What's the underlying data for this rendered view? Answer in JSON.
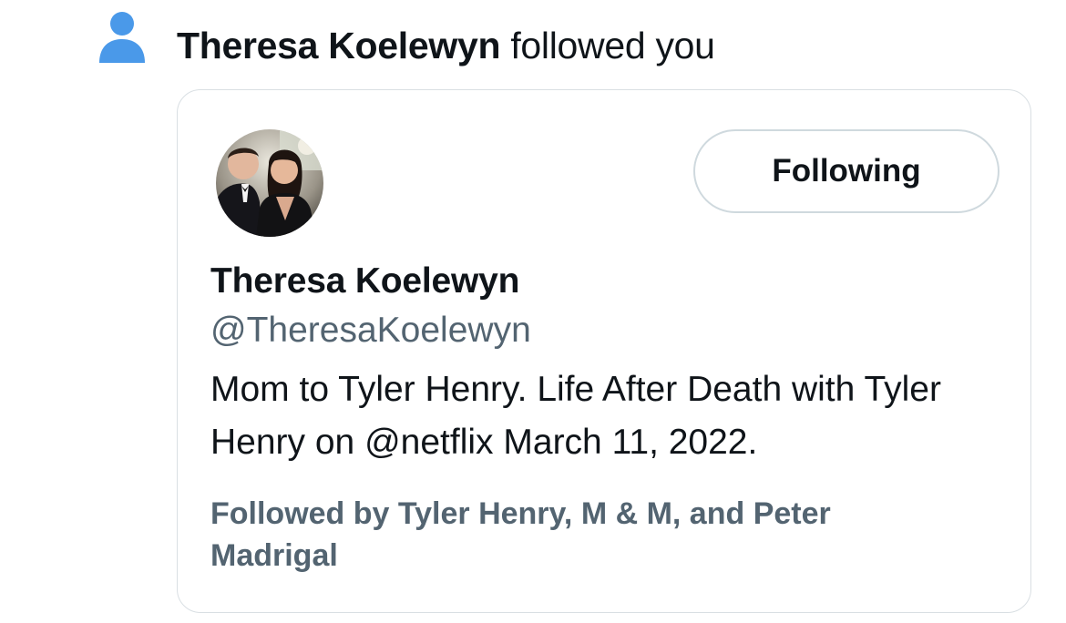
{
  "notification": {
    "icon": "person-icon",
    "icon_color": "#4a99e9",
    "follower_name": "Theresa Koelewyn",
    "action_text": "followed you"
  },
  "profile_card": {
    "avatar": "profile-photo",
    "follow_button_label": "Following",
    "display_name": "Theresa Koelewyn",
    "handle": "@TheresaKoelewyn",
    "bio": "Mom to Tyler Henry. Life After Death with Tyler Henry on @netflix March 11, 2022.",
    "followed_by": "Followed by Tyler Henry, M & M, and Peter Madrigal"
  },
  "colors": {
    "text_primary": "#0f1419",
    "text_secondary": "#536471",
    "border": "#d9dfe3",
    "button_border": "#cfd9de"
  }
}
